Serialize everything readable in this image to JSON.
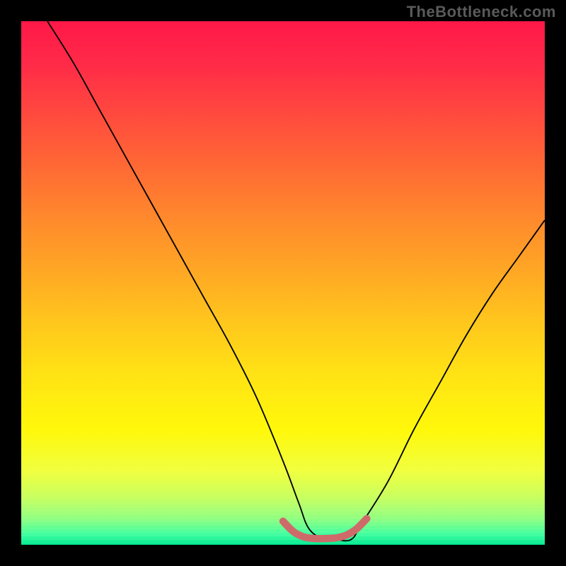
{
  "watermark": "TheBottleneck.com",
  "chart_data": {
    "type": "line",
    "title": "",
    "xlabel": "",
    "ylabel": "",
    "xlim": [
      0,
      100
    ],
    "ylim": [
      0,
      100
    ],
    "grid": false,
    "legend": false,
    "series": [
      {
        "name": "bottleneck-curve",
        "color": "#000000",
        "x": [
          5,
          10,
          15,
          20,
          25,
          30,
          35,
          40,
          45,
          50,
          53,
          55,
          58,
          60,
          63,
          65,
          70,
          75,
          80,
          85,
          90,
          95,
          100
        ],
        "y": [
          100,
          92,
          83,
          74,
          65,
          56,
          47,
          38,
          28,
          16,
          8,
          3,
          1,
          1,
          1,
          4,
          12,
          22,
          31,
          40,
          48,
          55,
          62
        ]
      },
      {
        "name": "optimal-zone-marker",
        "color": "#d66a6a",
        "x": [
          50,
          52,
          54,
          56,
          58,
          60,
          62,
          64,
          66
        ],
        "y": [
          4.5,
          2.5,
          1.5,
          1.2,
          1.2,
          1.3,
          1.8,
          3.0,
          5.0
        ]
      }
    ],
    "background": {
      "type": "vertical-gradient",
      "stops": [
        {
          "pos": 0,
          "color": "#ff1848"
        },
        {
          "pos": 50,
          "color": "#ffb020"
        },
        {
          "pos": 80,
          "color": "#fff000"
        },
        {
          "pos": 100,
          "color": "#00e890"
        }
      ]
    }
  }
}
